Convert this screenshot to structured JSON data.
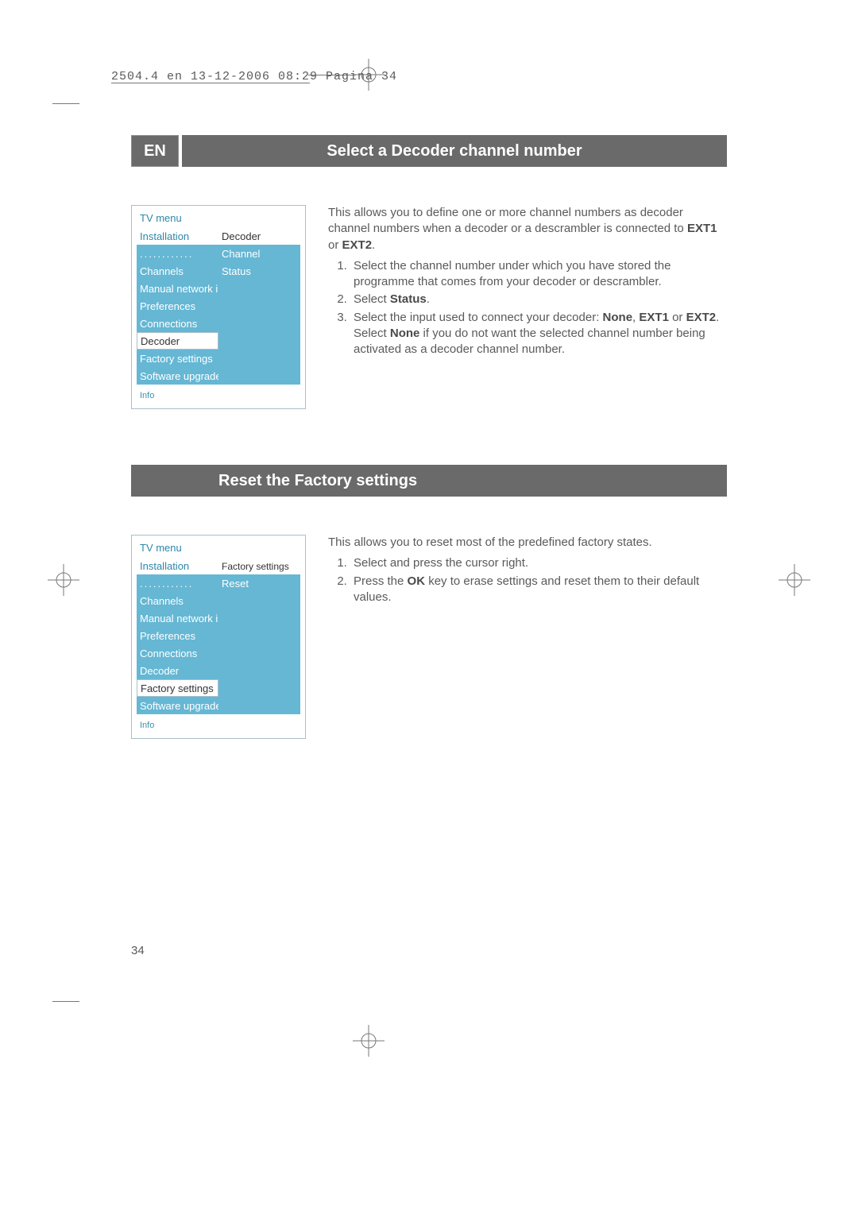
{
  "header": {
    "imprint": "2504.4 en  13-12-2006  08:29  Pagina 34"
  },
  "section1": {
    "lang": "EN",
    "title": "Select a Decoder channel number",
    "menu": {
      "title": "TV menu",
      "left": [
        "Installation",
        "............",
        "Channels",
        "Manual network i..",
        "Preferences",
        "Connections",
        "Decoder",
        "Factory settings",
        "Software upgrade"
      ],
      "right": [
        "Decoder",
        "Channel",
        "Status",
        "",
        "",
        "",
        "",
        "",
        ""
      ],
      "info": "Info"
    },
    "body": {
      "intro_a": "This allows you to define one or more channel numbers as decoder channel numbers when a decoder or a descrambler is connected to ",
      "intro_b_bold": "EXT1",
      "intro_or": " or ",
      "intro_c_bold": "EXT2",
      "intro_end": ".",
      "li1": "Select the channel number under which you have stored the programme that comes from your decoder or descrambler.",
      "li2_a": "Select ",
      "li2_b_bold": "Status",
      "li2_end": ".",
      "li3_a": "Select the input used to connect your decoder: ",
      "li3_none": "None",
      "li3_comma": ", ",
      "li3_ext1": "EXT1",
      "li3_or": " or ",
      "li3_ext2": "EXT2",
      "li3_end": ".",
      "li3_sub_a": "Select ",
      "li3_sub_none": "None",
      "li3_sub_b": " if you do not want the selected channel number being activated as a decoder channel number."
    }
  },
  "section2": {
    "title": "Reset the Factory settings",
    "menu": {
      "title": "TV menu",
      "left": [
        "Installation",
        "............",
        "Channels",
        "Manual network i..",
        "Preferences",
        "Connections",
        "Decoder",
        "Factory settings",
        "Software upgrade"
      ],
      "right": [
        "Factory settings",
        "Reset",
        "",
        "",
        "",
        "",
        "",
        "",
        ""
      ],
      "info": "Info"
    },
    "body": {
      "intro": "This allows you to reset most of the predefined factory states.",
      "li1": "Select and press the cursor right.",
      "li2_a": "Press the ",
      "li2_ok": "OK",
      "li2_b": " key to erase settings and reset them to their default values."
    }
  },
  "pageNumber": "34"
}
